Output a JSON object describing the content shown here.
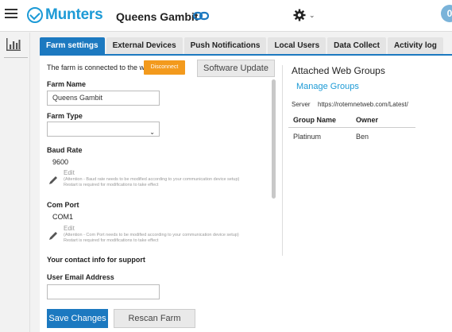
{
  "header": {
    "brand": "Munters",
    "farm_title": "Queens Gambit",
    "notification_count": "0",
    "icons": [
      "menu-icon",
      "munters-logo",
      "link-icon",
      "gear-icon",
      "chevron-down-icon",
      "notification-badge"
    ]
  },
  "sidebar": {
    "icons": [
      "bar-chart-icon"
    ]
  },
  "tabs": [
    {
      "label": "Farm settings",
      "active": true
    },
    {
      "label": "External Devices",
      "active": false
    },
    {
      "label": "Push Notifications",
      "active": false
    },
    {
      "label": "Local Users",
      "active": false
    },
    {
      "label": "Data Collect",
      "active": false
    },
    {
      "label": "Activity log",
      "active": false
    }
  ],
  "farm_settings": {
    "connection_text": "The farm is connected to the web",
    "disconnect_label": "Disconnect",
    "software_update_label": "Software Update",
    "farm_name_label": "Farm Name",
    "farm_name_value": "Queens Gambit",
    "farm_type_label": "Farm Type",
    "farm_type_value": "",
    "baud_rate_label": "Baud Rate",
    "baud_rate_value": "9600",
    "baud_edit_label": "Edit",
    "baud_edit_note_1": "(Attention - Baud rate needs to be modified according to your communication device setup)",
    "baud_edit_note_2": "Restart is required for modifications to take effect",
    "com_port_label": "Com Port",
    "com_port_value": "COM1",
    "com_edit_label": "Edit",
    "com_edit_note_1": "(Attention - Com Port needs to be modified according to your communication device setup)",
    "com_edit_note_2": "Restart is required for modifications to take effect",
    "support_heading": "Your contact info for support",
    "email_label": "User Email Address",
    "email_value": "",
    "save_label": "Save Changes",
    "rescan_label": "Rescan Farm Houses"
  },
  "web_groups": {
    "title": "Attached Web Groups",
    "manage_label": "Manage Groups",
    "server_label": "Server",
    "server_url": "https://rotemnetweb.com/Latest/",
    "columns": [
      "Group Name",
      "Owner"
    ],
    "rows": [
      {
        "group": "Platinum",
        "owner": "Ben"
      }
    ]
  },
  "colors": {
    "brand_blue": "#1c9ad6",
    "active_tab": "#1c79c0",
    "disconnect_orange": "#f39a1d"
  }
}
